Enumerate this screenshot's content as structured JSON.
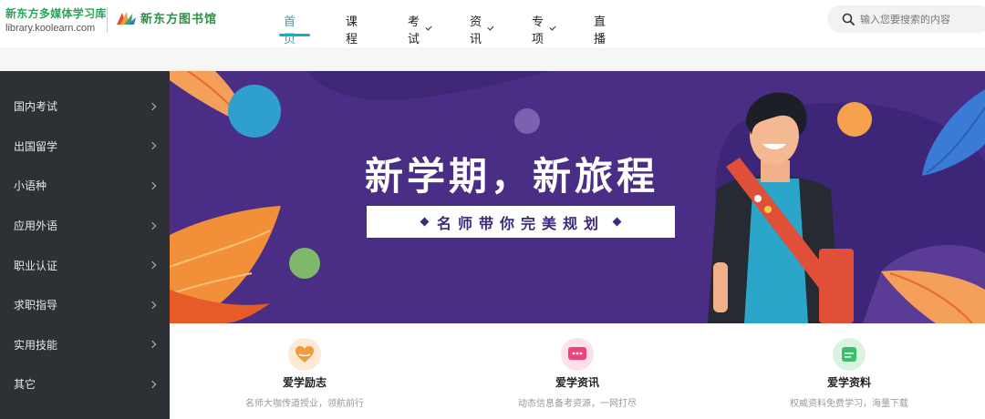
{
  "header": {
    "logo_title": "新东方多媒体学习库",
    "logo_url": "library.koolearn.com",
    "logo2_text": "新东方图书馆"
  },
  "nav": {
    "items": [
      {
        "label": "首页",
        "dropdown": false,
        "active": true
      },
      {
        "label": "课程",
        "dropdown": false
      },
      {
        "label": "考试",
        "dropdown": true
      },
      {
        "label": "资讯",
        "dropdown": true
      },
      {
        "label": "专项",
        "dropdown": true
      },
      {
        "label": "直播课",
        "dropdown": false
      }
    ]
  },
  "search": {
    "placeholder": "输入您要搜索的内容"
  },
  "sidebar": {
    "items": [
      {
        "label": "国内考试"
      },
      {
        "label": "出国留学"
      },
      {
        "label": "小语种"
      },
      {
        "label": "应用外语"
      },
      {
        "label": "职业认证"
      },
      {
        "label": "求职指导"
      },
      {
        "label": "实用技能"
      },
      {
        "label": "其它"
      }
    ]
  },
  "banner": {
    "headline": "新学期，新旅程",
    "subtitle": "名师带你完美规划"
  },
  "features": [
    {
      "title": "爱学励志",
      "desc": "名师大咖传道授业，领航前行",
      "icon": "heart-icon",
      "color": "#f39a3c"
    },
    {
      "title": "爱学资讯",
      "desc": "动态信息备考资源，一网打尽",
      "icon": "message-icon",
      "color": "#f0427a"
    },
    {
      "title": "爱学资料",
      "desc": "权威资料免费学习，海量下载",
      "icon": "document-icon",
      "color": "#3cbf6a"
    }
  ],
  "colors": {
    "accent": "#0bb3c2",
    "sidebar_bg": "#2d3136",
    "banner_bg": "#4a2d85"
  }
}
